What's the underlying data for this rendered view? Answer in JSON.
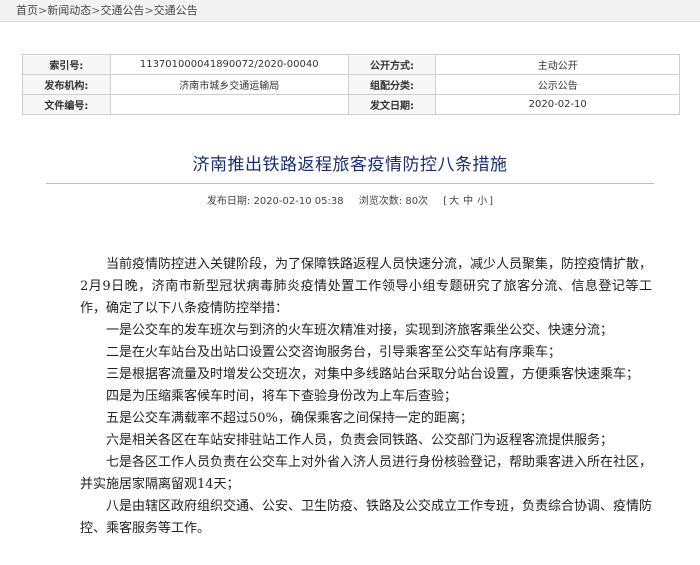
{
  "breadcrumb": {
    "home": "首页",
    "news": "新闻动态",
    "traffic1": "交通公告",
    "traffic2": "交通公告",
    "sep": ">"
  },
  "meta": {
    "index_label": "索引号:",
    "index_value": "113701000041890072/2020-00040",
    "open_label": "公开方式:",
    "open_value": "主动公开",
    "publisher_label": "发布机构:",
    "publisher_value": "济南市城乡交通运输局",
    "category_label": "组配分类:",
    "category_value": "公示公告",
    "doc_label": "文件编号:",
    "doc_value": "",
    "date_label": "发文日期:",
    "date_value": "2020-02-10"
  },
  "article": {
    "title": "济南推出铁路返程旅客疫情防控八条措施",
    "publish_label": "发布日期: 2020-02-10 05:38",
    "views_label": "浏览次数: 80次",
    "font_prefix": "[",
    "font_large": "大",
    "font_medium": "中",
    "font_small": "小",
    "font_suffix": "]",
    "paragraphs": [
      "当前疫情防控进入关键阶段，为了保障铁路返程人员快速分流，减少人员聚集，防控疫情扩散，2月9日晚，济南市新型冠状病毒肺炎疫情处置工作领导小组专题研究了旅客分流、信息登记等工作，确定了以下八条疫情防控举措：",
      "一是公交车的发车班次与到济的火车班次精准对接，实现到济旅客乘坐公交、快速分流；",
      "二是在火车站台及出站口设置公交咨询服务台，引导乘客至公交车站有序乘车；",
      "三是根据客流量及时增发公交班次，对集中多线路站台采取分站台设置，方便乘客快速乘车；",
      "四是为压缩乘客候车时间，将车下查验身份改为上车后查验；",
      "五是公交车满载率不超过50%，确保乘客之间保持一定的距离；",
      "六是相关各区在车站安排驻站工作人员，负责会同铁路、公交部门为返程客流提供服务；",
      "七是各区工作人员负责在公交车上对外省入济人员进行身份核验登记，帮助乘客进入所在社区，并实施居家隔离留观14天；",
      "八是由辖区政府组织交通、公安、卫生防疫、铁路及公交成立工作专班，负责综合协调、疫情防控、乘客服务等工作。"
    ]
  }
}
